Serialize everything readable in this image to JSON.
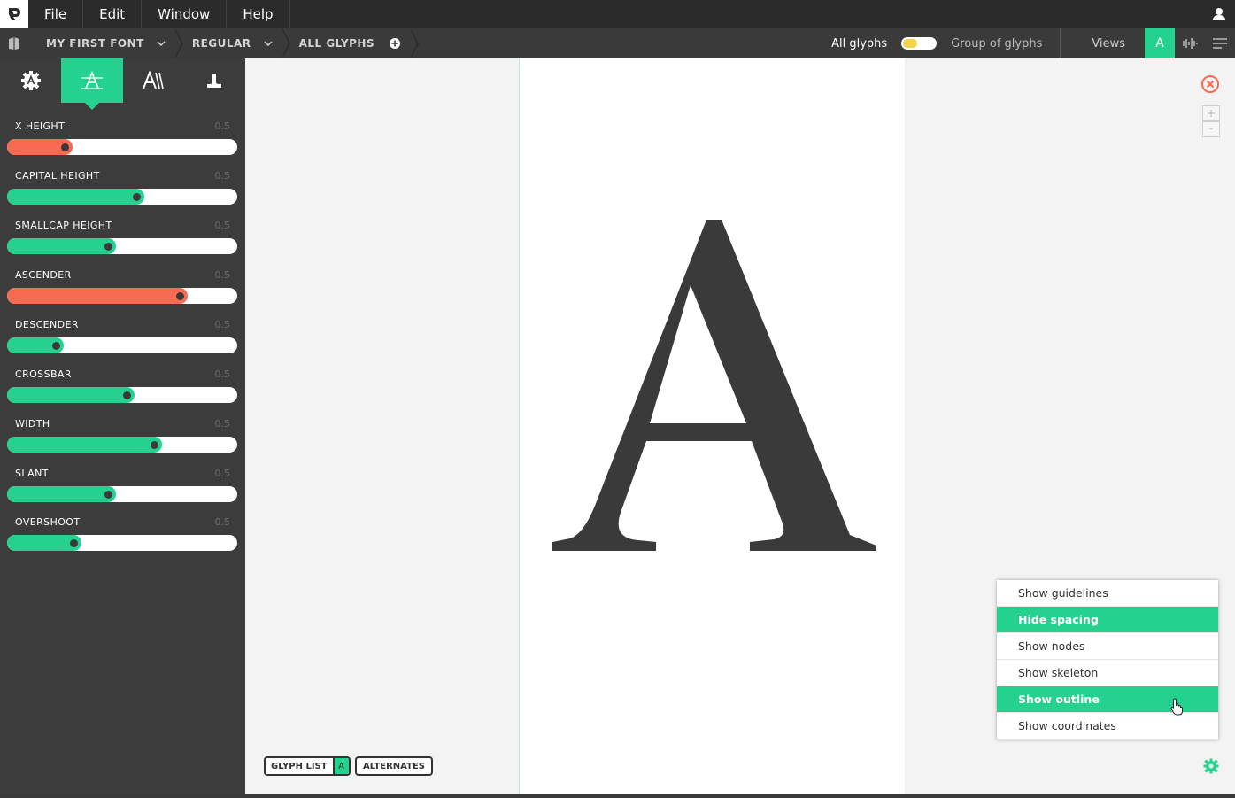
{
  "menubar": {
    "items": [
      "File",
      "Edit",
      "Window",
      "Help"
    ]
  },
  "toolbar": {
    "font_name": "MY FIRST FONT",
    "variant": "REGULAR",
    "glyph_scope": "ALL GLYPHS",
    "all_glyphs_label": "All glyphs",
    "group_label": "Group of glyphs",
    "views_label": "Views",
    "view_a_label": "A"
  },
  "sidebar": {
    "sliders": [
      {
        "label": "X HEIGHT",
        "value": "0.5",
        "position": 0.25,
        "color": "#f96a52"
      },
      {
        "label": "CAPITAL HEIGHT",
        "value": "0.5",
        "position": 0.56,
        "color": "#24d18f"
      },
      {
        "label": "SMALLCAP HEIGHT",
        "value": "0.5",
        "position": 0.44,
        "color": "#24d18f"
      },
      {
        "label": "ASCENDER",
        "value": "0.5",
        "position": 0.75,
        "color": "#f96a52"
      },
      {
        "label": "DESCENDER",
        "value": "0.5",
        "position": 0.21,
        "color": "#24d18f"
      },
      {
        "label": "CROSSBAR",
        "value": "0.5",
        "position": 0.52,
        "color": "#24d18f"
      },
      {
        "label": "WIDTH",
        "value": "0.5",
        "position": 0.64,
        "color": "#24d18f"
      },
      {
        "label": "SLANT",
        "value": "0.5",
        "position": 0.44,
        "color": "#24d18f"
      },
      {
        "label": "OVERSHOOT",
        "value": "0.5",
        "position": 0.29,
        "color": "#24d18f"
      }
    ]
  },
  "canvas": {
    "glyph_char": "A",
    "glyph_list_label": "GLYPH LIST",
    "glyph_list_current": "A",
    "alternates_label": "ALTERNATES",
    "zoom_in": "+",
    "zoom_out": "-"
  },
  "context_menu": {
    "items": [
      {
        "label": "Show guidelines",
        "active": false
      },
      {
        "label": "Hide spacing",
        "active": true
      },
      {
        "label": "Show nodes",
        "active": false
      },
      {
        "label": "Show skeleton",
        "active": false
      },
      {
        "label": "Show outline",
        "active": true
      },
      {
        "label": "Show coordinates",
        "active": false
      }
    ]
  },
  "colors": {
    "accent": "#24d18f",
    "warning": "#f96a52",
    "toggle": "#f2d34a",
    "dark": "#3a3a3a"
  }
}
